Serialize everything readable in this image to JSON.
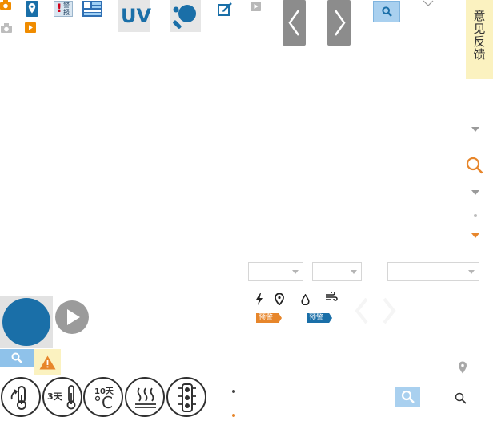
{
  "feedback": {
    "label_chars": [
      "意",
      "见",
      "反",
      "馈"
    ]
  },
  "icons": {
    "top_row": [
      "camera-icon",
      "map-pin-icon",
      "warning-report-icon",
      "weather-station-icon",
      "uv-icon",
      "table-tennis-icon",
      "edit-icon",
      "video-play-icon"
    ],
    "second_row": [
      "camera-icon",
      "video-play-icon"
    ],
    "weather_elements": [
      "lightning-icon",
      "map-pin-icon",
      "water-drop-icon",
      "wind-icon"
    ],
    "bottom_circles": [
      "temperature-trend-icon",
      "three-day-temperature-icon",
      "ten-day-temperature-icon",
      "heat-haze-icon",
      "traffic-light-icon"
    ]
  },
  "tiles": {
    "uv_text": "UV",
    "warn_text_a": "警",
    "warn_text_b": "报",
    "three_day": "3天",
    "ten_day": "10天",
    "celsius": "°C"
  },
  "warnings": {
    "tag_left": "预警",
    "tag_right": "预警"
  },
  "colors": {
    "accent_blue": "#1a6fa8",
    "accent_orange": "#e7862b",
    "feedback_bg": "#fbf2c0",
    "search_bg": "#a9d0ef"
  }
}
